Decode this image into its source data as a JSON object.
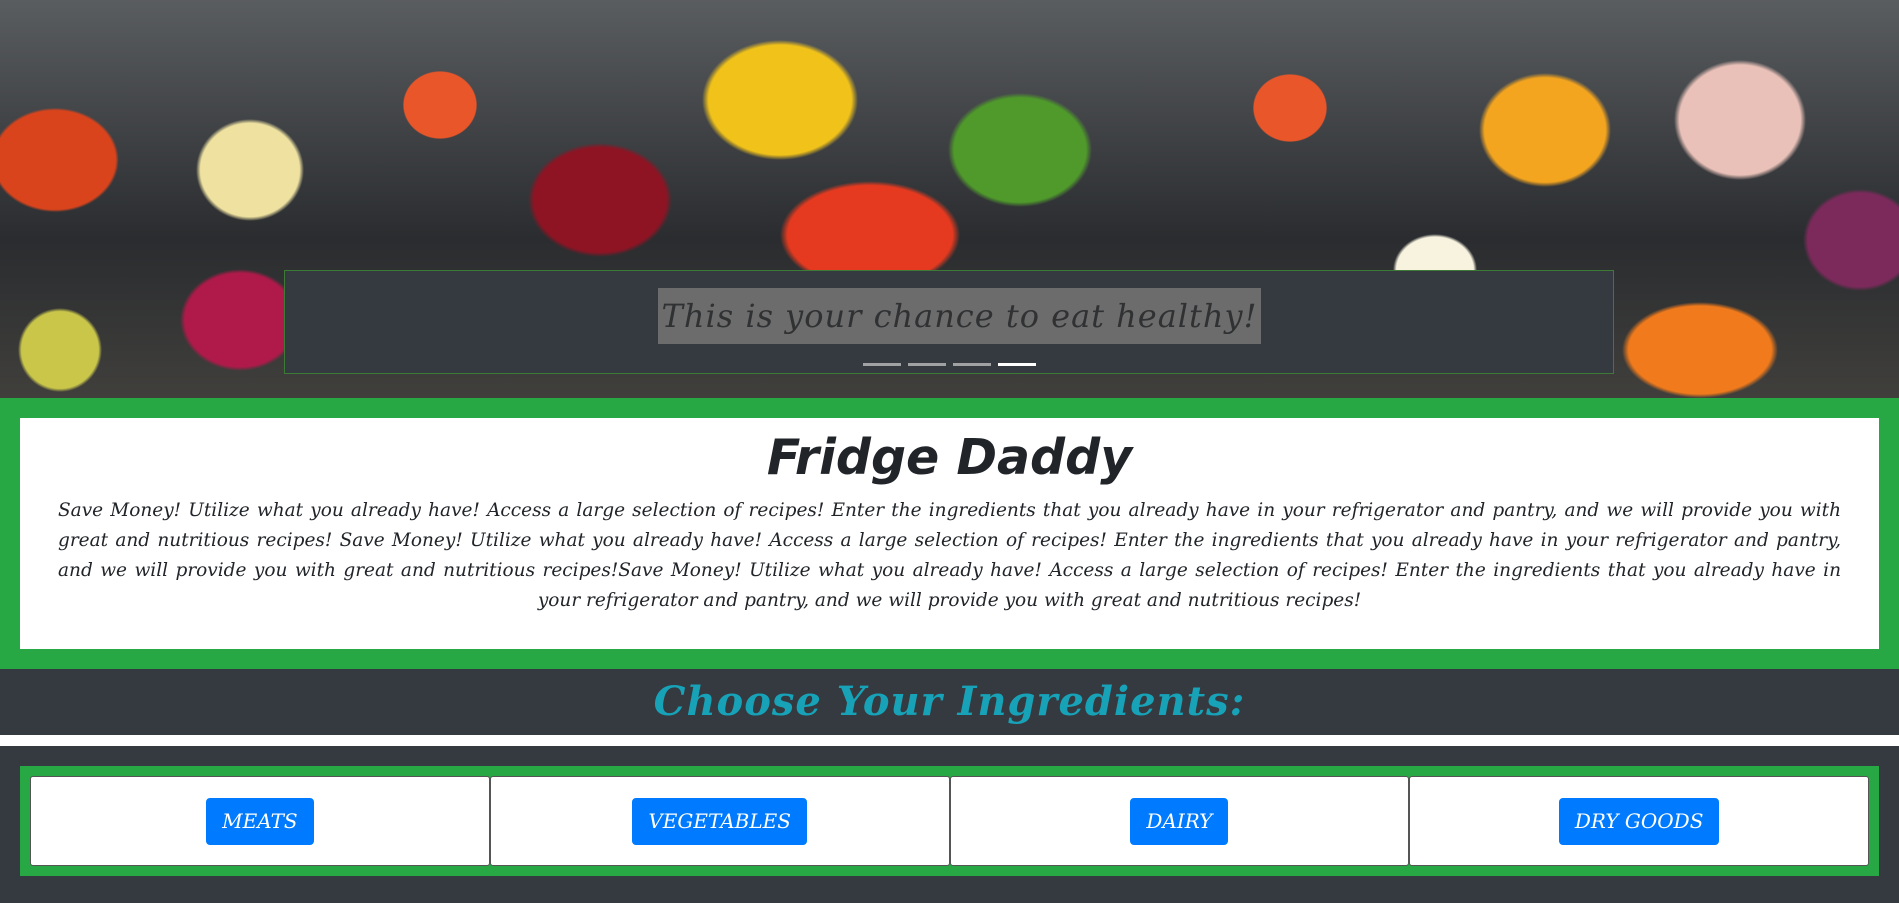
{
  "hero": {
    "caption": "This is your chance to eat healthy!",
    "indicators": [
      {
        "active": false
      },
      {
        "active": false
      },
      {
        "active": false
      },
      {
        "active": true
      }
    ]
  },
  "intro": {
    "title": "Fridge Daddy",
    "text": "Save Money! Utilize what you already have! Access a large selection of recipes! Enter the ingredients that you already have in your refrigerator and pantry, and we will provide you with great and nutritious recipes! Save Money! Utilize what you already have! Access a large selection of recipes! Enter the ingredients that you already have in your refrigerator and pantry, and we will provide you with great and nutritious recipes!Save Money! Utilize what you already have! Access a large selection of recipes! Enter the ingredients that you already have in your refrigerator and pantry, and we will provide you with great and nutritious recipes!"
  },
  "choose": {
    "title": "Choose Your Ingredients:"
  },
  "categories": {
    "meats": "MEATS",
    "vegetables": "VEGETABLES",
    "dairy": "DAIRY",
    "dry_goods": "DRY GOODS"
  },
  "colors": {
    "accent_green": "#28a745",
    "dark": "#343a40",
    "button_blue": "#007bff",
    "heading_teal": "#17a2b8"
  }
}
